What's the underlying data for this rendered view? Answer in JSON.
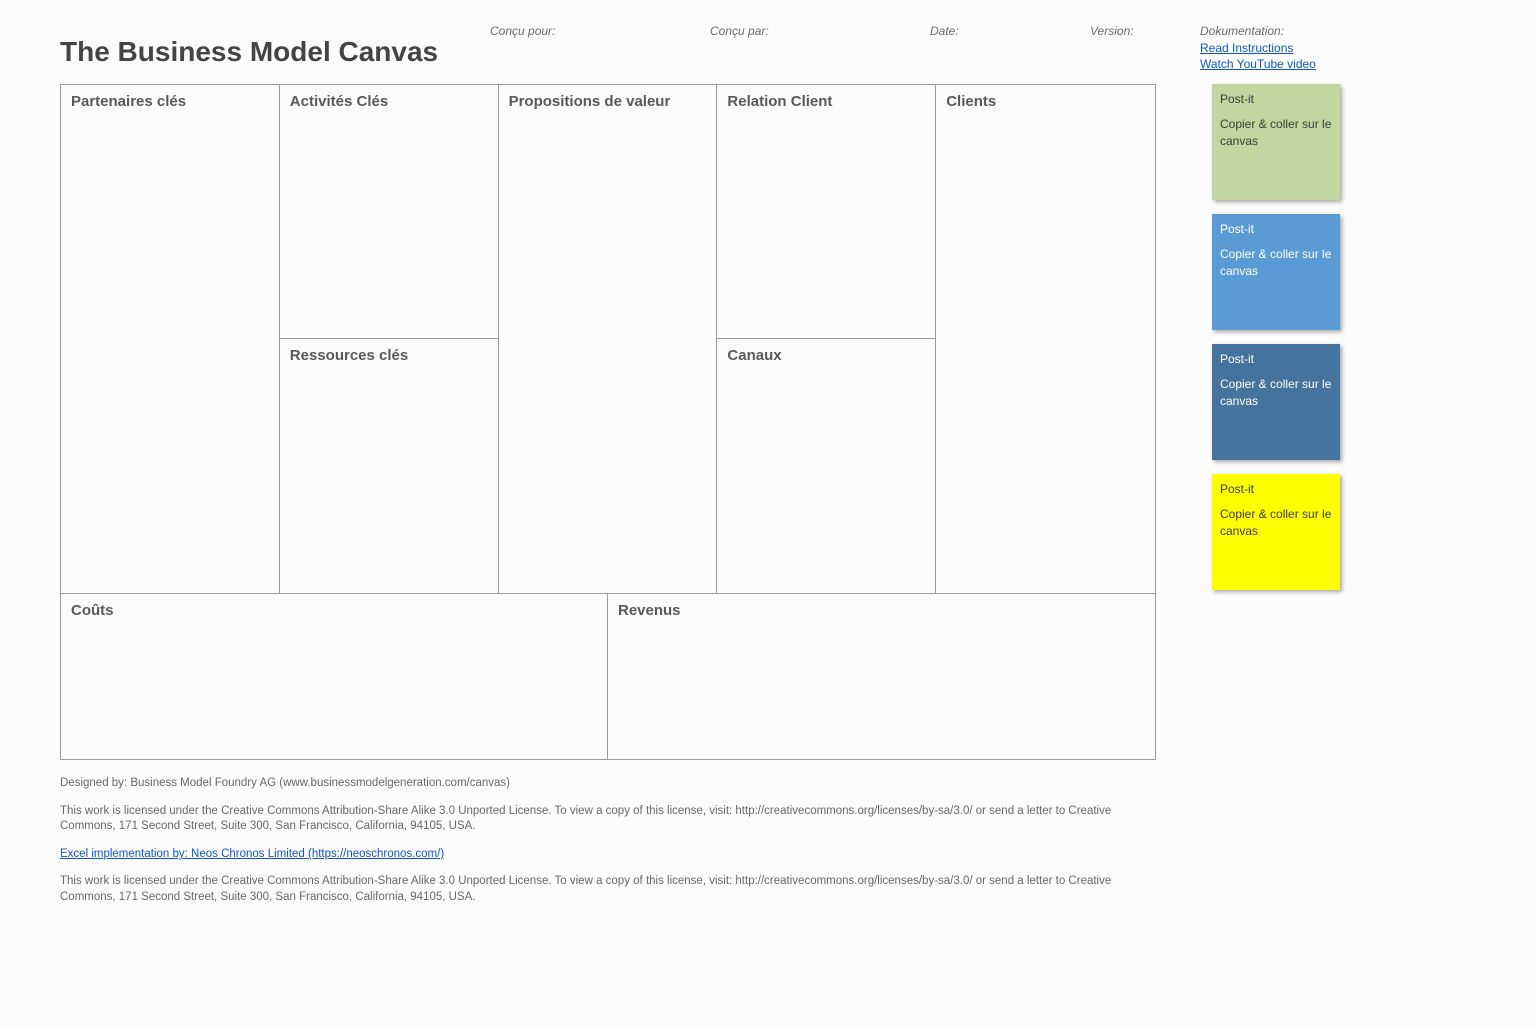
{
  "title": "The Business Model Canvas",
  "meta": {
    "designed_for_label": "Conçu pour:",
    "designed_by_label": "Conçu par:",
    "date_label": "Date:",
    "version_label": "Version:",
    "doc_label": "Dokumentation:",
    "link_instructions": "Read Instructions",
    "link_youtube": "Watch YouTube video"
  },
  "canvas": {
    "key_partners": "Partenaires clés",
    "key_activities": "Activités Clés",
    "key_resources": "Ressources clés",
    "value_propositions": "Propositions de valeur",
    "customer_relationships": "Relation Client",
    "channels": "Canaux",
    "customer_segments": "Clients",
    "cost_structure": "Coûts",
    "revenue_streams": "Revenus"
  },
  "postits": [
    {
      "title": "Post-it",
      "body": "Copier & coller sur le canvas",
      "color": "green"
    },
    {
      "title": "Post-it",
      "body": "Copier & coller sur le canvas",
      "color": "blue"
    },
    {
      "title": "Post-it",
      "body": "Copier & coller sur le canvas",
      "color": "dblue"
    },
    {
      "title": "Post-it",
      "body": "Copier & coller sur le canvas",
      "color": "yellow"
    }
  ],
  "footer": {
    "designed_by": "Designed by: Business Model Foundry AG (www.businessmodelgeneration.com/canvas)",
    "license1": "This work is licensed under the Creative Commons Attribution-Share Alike 3.0 Unported License. To view a copy of this license, visit: http://creativecommons.org/licenses/by-sa/3.0/ or send a letter to Creative Commons, 171 Second Street, Suite 300, San Francisco, California, 94105, USA.",
    "excel_impl": "Excel implementation by: Neos Chronos Limited (https://neoschronos.com/)",
    "license2": "This work is licensed under the Creative Commons Attribution-Share Alike 3.0 Unported License. To view a copy of this license, visit: http://creativecommons.org/licenses/by-sa/3.0/ or send a letter to Creative Commons, 171 Second Street, Suite 300, San Francisco, California, 94105, USA."
  }
}
